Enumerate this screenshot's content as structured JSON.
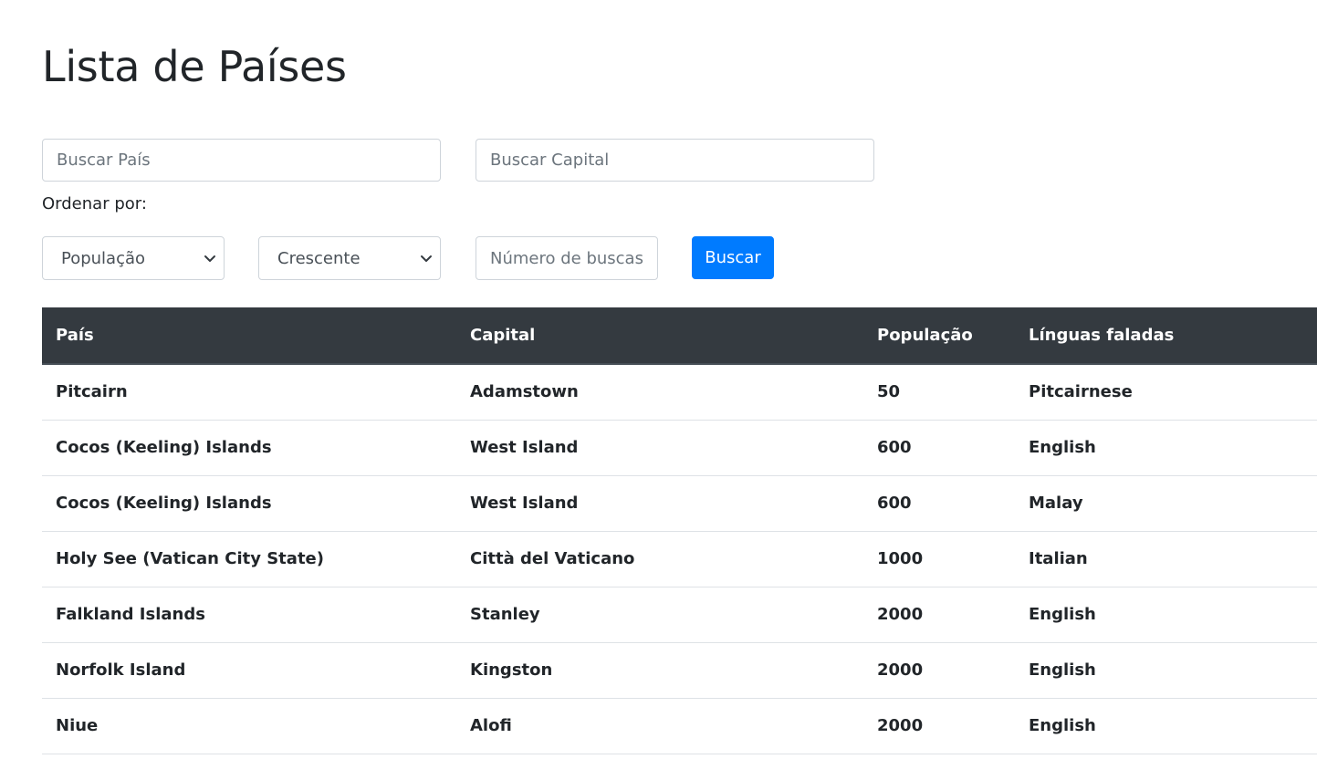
{
  "page": {
    "title": "Lista de Países"
  },
  "filters": {
    "country_placeholder": "Buscar País",
    "capital_placeholder": "Buscar Capital",
    "order_label": "Ordenar por:",
    "order_field_selected": "População",
    "order_direction_selected": "Crescente",
    "num_searches_placeholder": "Número de buscas",
    "search_button_label": "Buscar"
  },
  "table": {
    "headers": [
      "País",
      "Capital",
      "População",
      "Línguas faladas"
    ],
    "rows": [
      [
        "Pitcairn",
        "Adamstown",
        "50",
        "Pitcairnese"
      ],
      [
        "Cocos (Keeling) Islands",
        "West Island",
        "600",
        "English"
      ],
      [
        "Cocos (Keeling) Islands",
        "West Island",
        "600",
        "Malay"
      ],
      [
        "Holy See (Vatican City State)",
        "Città del Vaticano",
        "1000",
        "Italian"
      ],
      [
        "Falkland Islands",
        "Stanley",
        "2000",
        "English"
      ],
      [
        "Norfolk Island",
        "Kingston",
        "2000",
        "English"
      ],
      [
        "Niue",
        "Alofi",
        "2000",
        "English"
      ]
    ]
  },
  "colors": {
    "primary": "#007bff",
    "table_header_bg": "#343a40",
    "text": "#212529"
  },
  "icons": {
    "select_caret": "chevron-down-icon"
  }
}
